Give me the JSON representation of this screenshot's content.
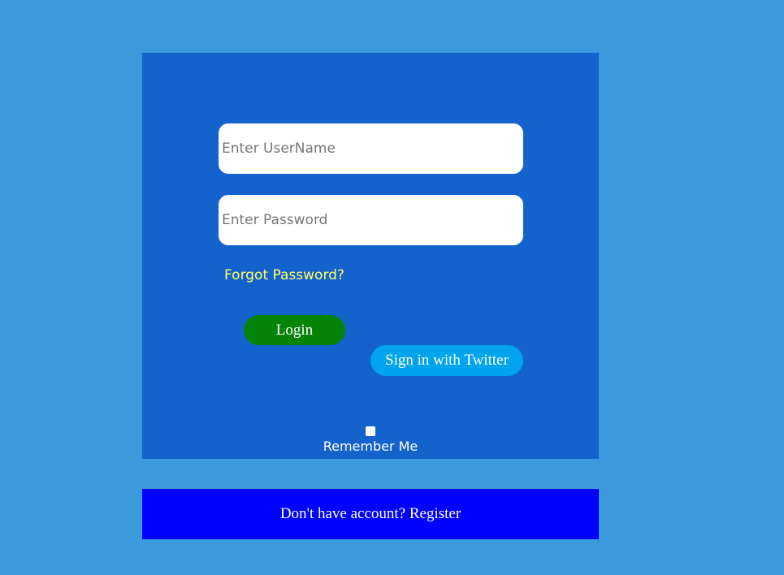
{
  "login_form": {
    "username_placeholder": "Enter UserName",
    "username_value": "",
    "password_placeholder": "Enter Password",
    "password_value": "",
    "forgot_password_label": "Forgot Password?",
    "login_label": "Login",
    "twitter_label": "Sign in with Twitter",
    "remember_label": "Remember Me",
    "remember_checked": false
  },
  "register": {
    "text": "Don't have account? Register"
  },
  "colors": {
    "page_background": "#3c9adc",
    "panel_background": "#1463cc",
    "login_button": "#068407",
    "twitter_button": "#00a4ec",
    "forgot_link": "#ffff66",
    "register_bar": "#0000ff"
  }
}
